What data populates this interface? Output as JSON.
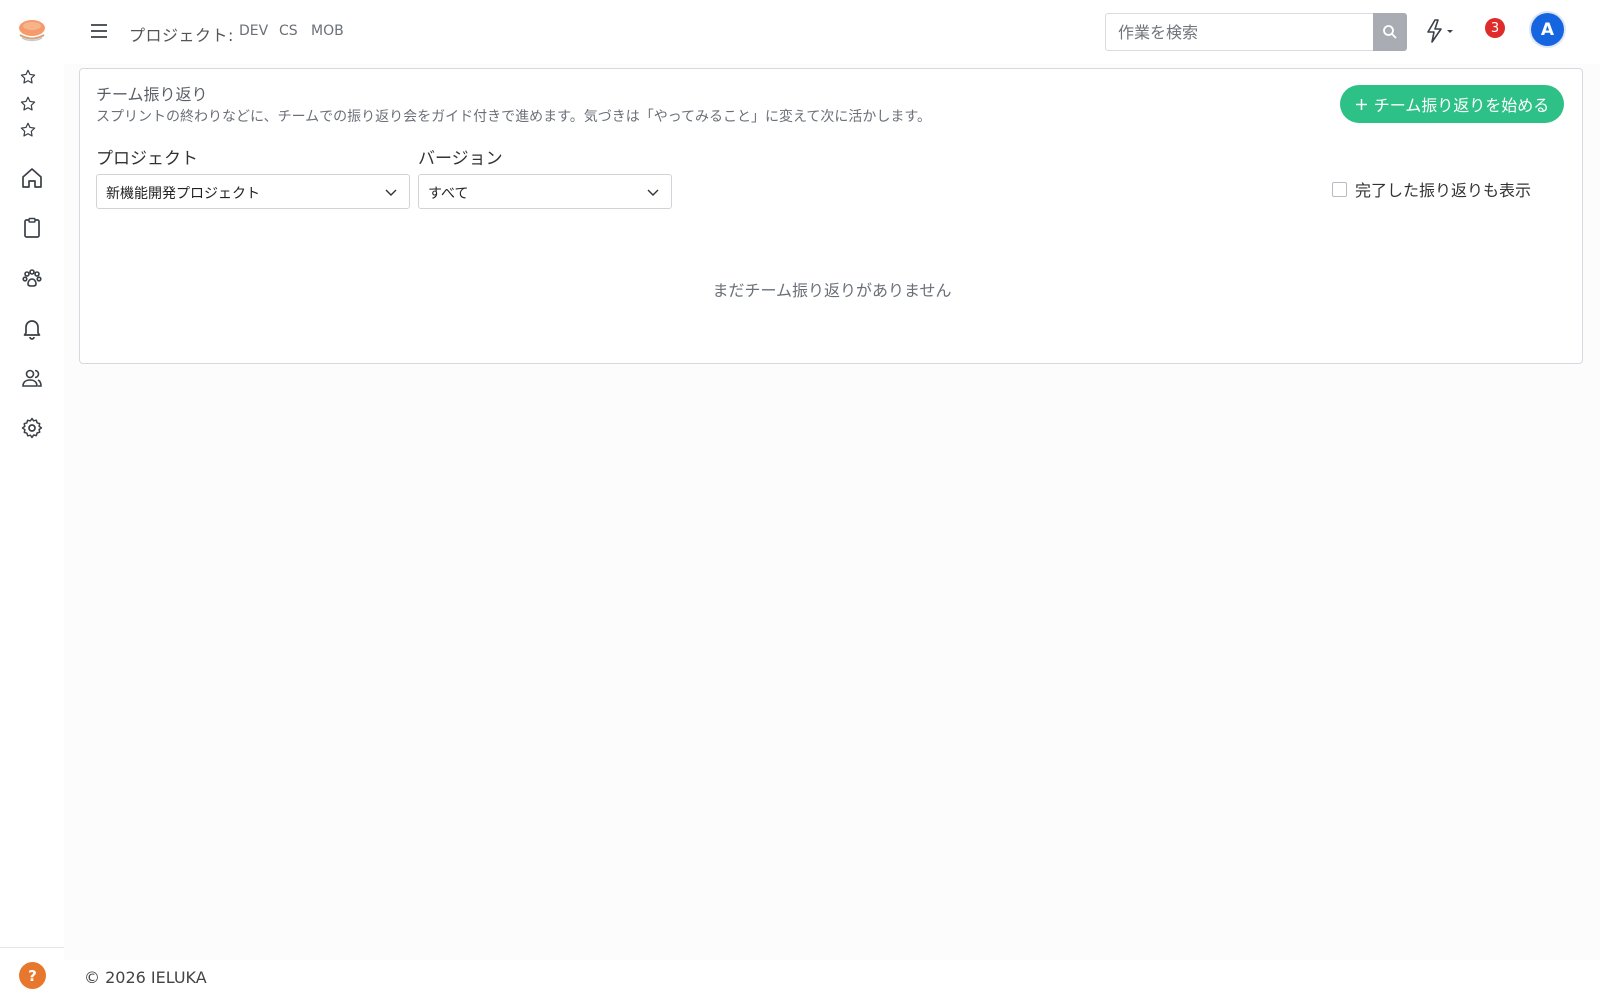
{
  "header": {
    "project_prefix": "プロジェクト:",
    "projects": [
      "DEV",
      "CS",
      "MOB"
    ],
    "search_placeholder": "作業を検索",
    "notification_count": "3",
    "avatar_initial": "A"
  },
  "sidebar": {
    "help_label": "?"
  },
  "page": {
    "title": "チーム振り返り",
    "description": "スプリントの終わりなどに、チームでの振り返り会をガイド付きで進めます。気づきは「やってみること」に変えて次に活かします。",
    "start_button": "チーム振り返りを始める",
    "project_label": "プロジェクト",
    "project_value": "新機能開発プロジェクト",
    "version_label": "バージョン",
    "version_value": "すべて",
    "show_completed_label": "完了した振り返りも表示",
    "empty_message": "まだチーム振り返りがありません"
  },
  "footer": {
    "copyright": "© 2026 IELUKA"
  },
  "colors": {
    "accent_green": "#2ec187",
    "badge_red": "#e02b2b",
    "avatar_blue": "#1565e0",
    "help_orange": "#e8772e"
  }
}
